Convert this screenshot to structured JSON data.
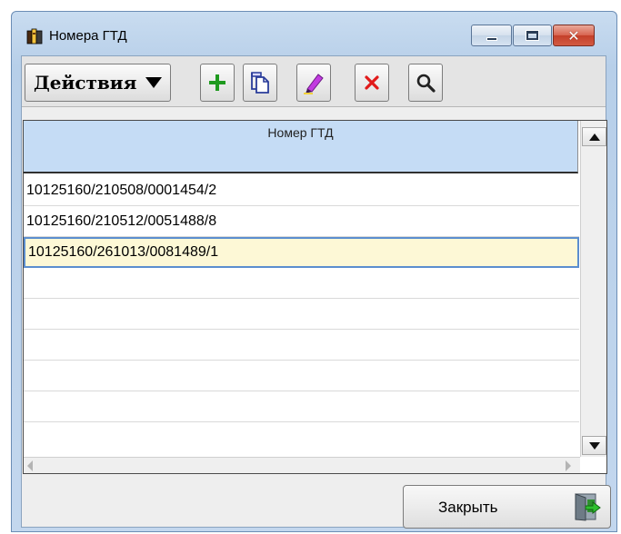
{
  "window": {
    "title": "Номера ГТД",
    "controls": {
      "minimize": "minimize",
      "maximize": "maximize",
      "close": "close"
    }
  },
  "toolbar": {
    "actions_label": "Действия",
    "buttons": [
      {
        "name": "add",
        "icon": "plus-icon",
        "color": "#1f9a1f"
      },
      {
        "name": "copy",
        "icon": "copy-icon",
        "color": "#3a4fa8"
      },
      {
        "name": "edit",
        "icon": "pencil-icon",
        "color": "#b52ad6"
      },
      {
        "name": "delete",
        "icon": "close-icon",
        "color": "#e11a1a"
      },
      {
        "name": "search",
        "icon": "search-icon",
        "color": "#222222"
      }
    ]
  },
  "grid": {
    "column_header": "Номер ГТД",
    "rows": [
      "10125160/210508/0001454/2",
      "10125160/210512/0051488/8",
      "10125160/261013/0081489/1",
      "",
      "",
      "",
      "",
      ""
    ],
    "selected_row": 2
  },
  "footer": {
    "close_label": "Закрыть"
  },
  "colors": {
    "header_bg": "#c5dcf5",
    "selected_bg": "#fdf8d6",
    "selected_border": "#5b8ecf",
    "titlebar_bg": "#b7cfe9"
  }
}
